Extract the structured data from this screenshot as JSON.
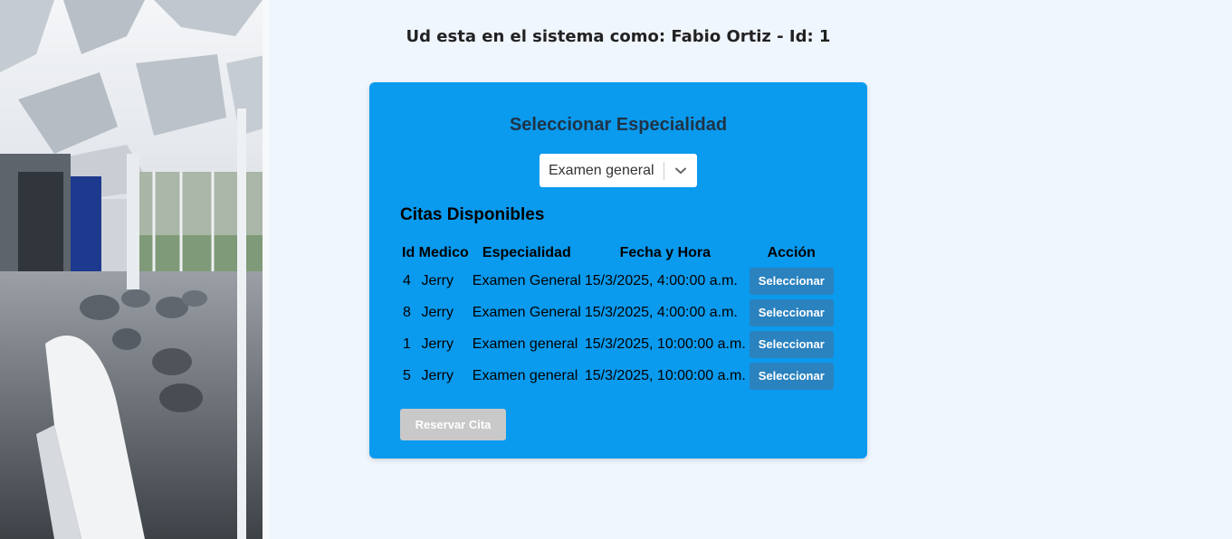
{
  "header": {
    "user_line": "Ud esta en el sistema como: Fabio Ortiz - Id: 1"
  },
  "form": {
    "title": "Seleccionar Especialidad",
    "specialty_select": {
      "value": "Examen general",
      "icon": "chevron-down-icon"
    },
    "appointments_title": "Citas Disponibles",
    "columns": [
      "Id Medico",
      "Especialidad",
      "Fecha y Hora",
      "Acción"
    ],
    "rows": [
      {
        "id": "4",
        "doctor": "Jerry",
        "specialty": "Examen General",
        "datetime": "15/3/2025, 4:00:00 a.m.",
        "action": "Seleccionar"
      },
      {
        "id": "8",
        "doctor": "Jerry",
        "specialty": "Examen General",
        "datetime": "15/3/2025, 4:00:00 a.m.",
        "action": "Seleccionar"
      },
      {
        "id": "1",
        "doctor": "Jerry",
        "specialty": "Examen general",
        "datetime": "15/3/2025, 10:00:00 a.m.",
        "action": "Seleccionar"
      },
      {
        "id": "5",
        "doctor": "Jerry",
        "specialty": "Examen general",
        "datetime": "15/3/2025, 10:00:00 a.m.",
        "action": "Seleccionar"
      }
    ],
    "reserve_label": "Reservar Cita"
  },
  "colors": {
    "page_bg": "#f0f6fd",
    "card_bg": "#0a9aee",
    "button_bg": "#2a82bf",
    "disabled_button_bg": "#c9c9c9"
  }
}
